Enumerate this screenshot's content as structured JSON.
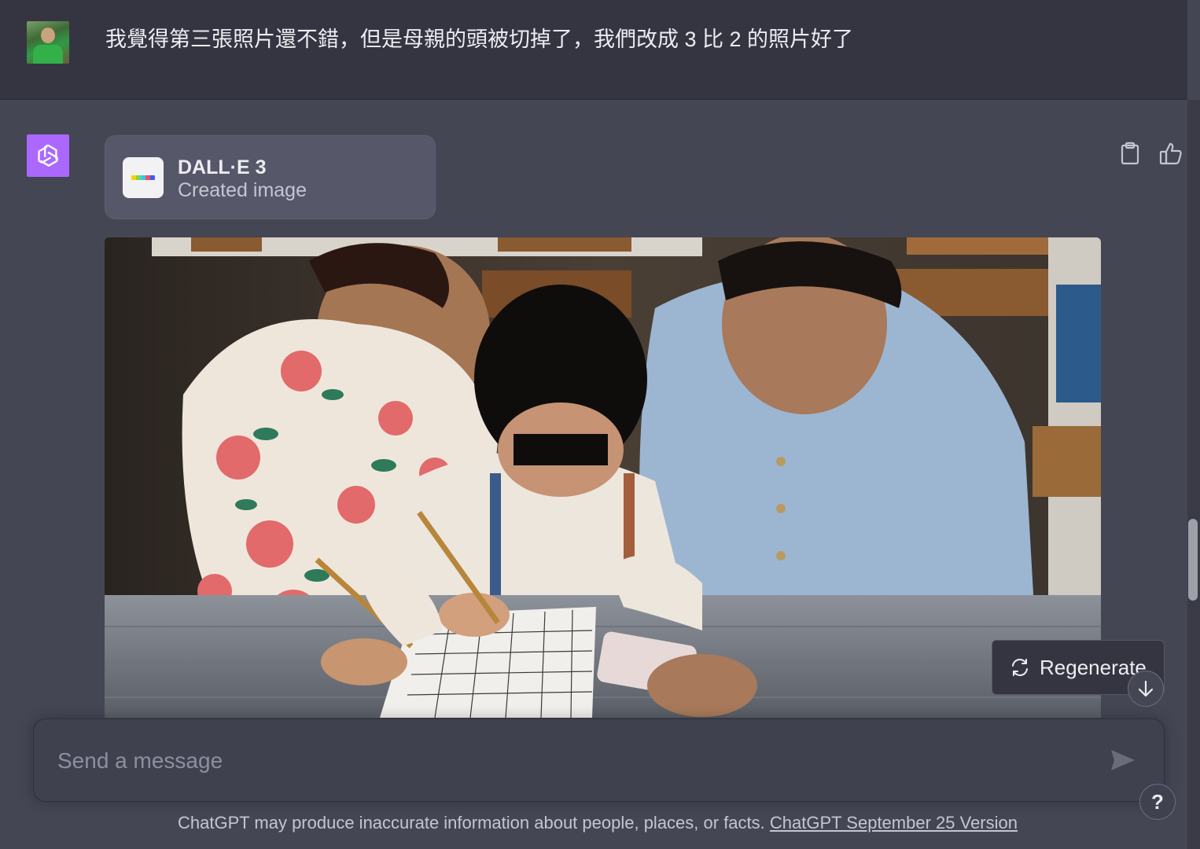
{
  "user_message": {
    "text": "我覺得第三張照片還不錯，但是母親的頭被切掉了，我們改成 3 比 2 的照片好了",
    "avatar_icon": "user-avatar-photo"
  },
  "assistant_message": {
    "avatar_icon": "openai-logo-icon",
    "tool": {
      "name": "DALL·E 3",
      "status": "Created image",
      "icon": "dalle-color-bar-icon"
    },
    "actions": [
      "clipboard-icon",
      "thumbs-up-icon"
    ],
    "image_icon": "generated-image"
  },
  "regenerate": {
    "label": "Regenerate",
    "icon": "refresh-icon"
  },
  "composer": {
    "placeholder": "Send a message",
    "send_icon": "send-icon"
  },
  "footer": {
    "disclaimer": "ChatGPT may produce inaccurate information about people, places, or facts.",
    "version_link": "ChatGPT September 25 Version"
  },
  "help": {
    "label": "?"
  },
  "colors": {
    "page_bg": "#444654",
    "user_row_bg": "#343541",
    "gpt_accent": "#ab68ff",
    "card_bg": "#565869",
    "text": "#ececf1"
  }
}
